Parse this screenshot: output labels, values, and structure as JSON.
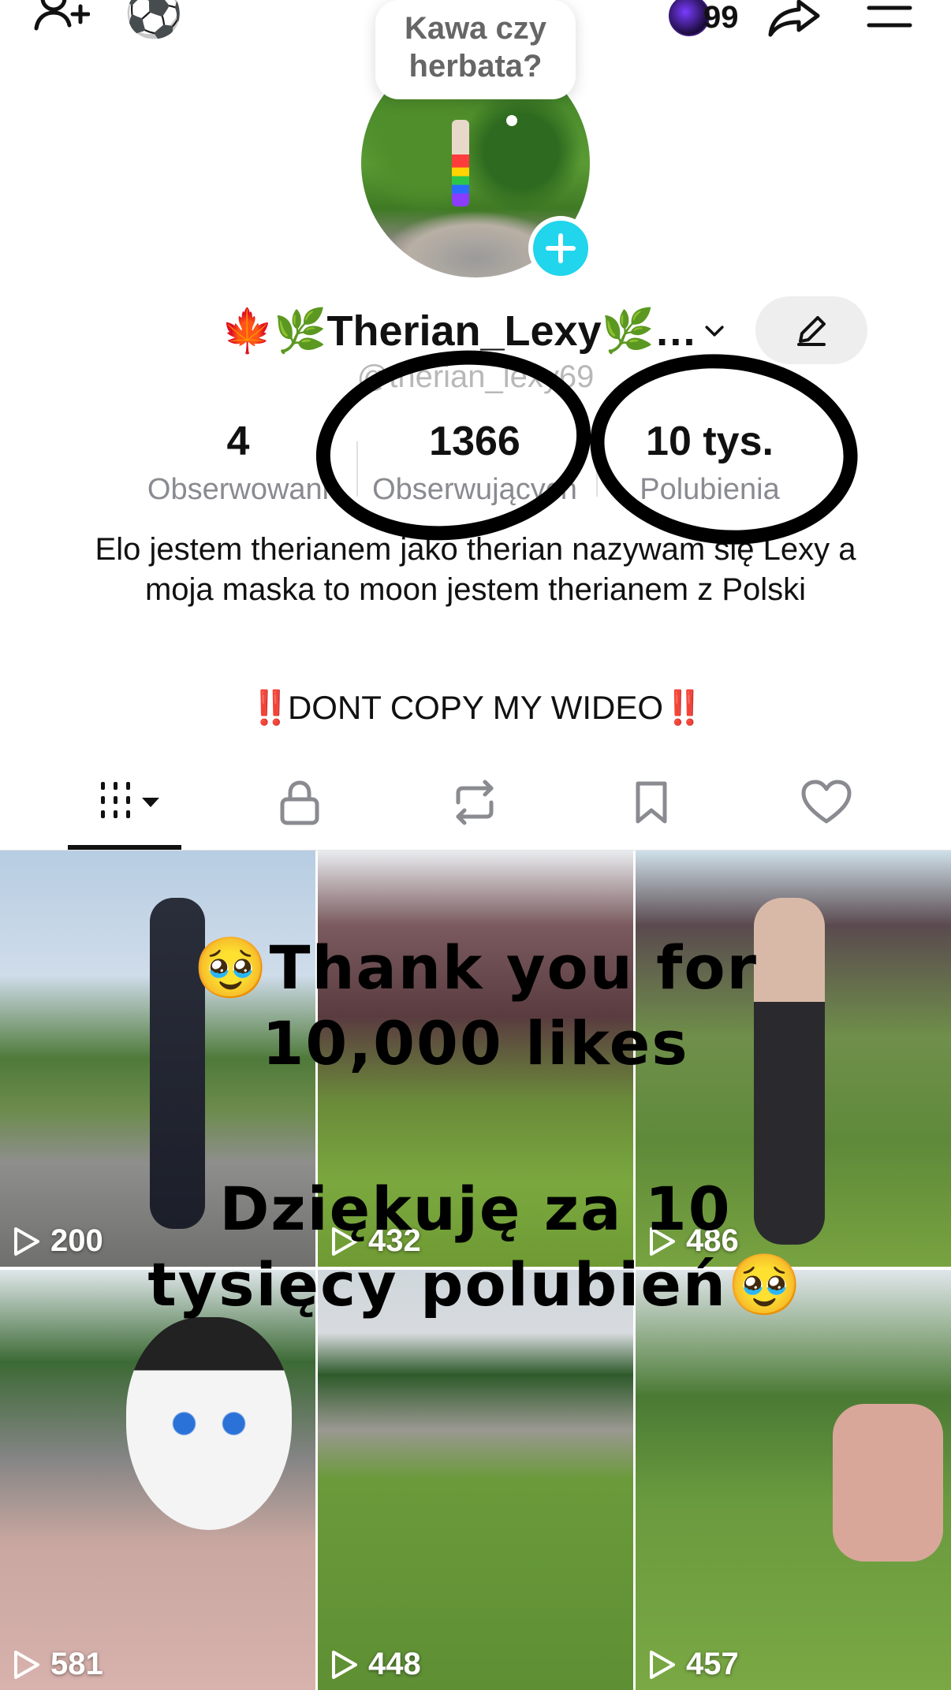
{
  "top_bar": {
    "badge_count": "99",
    "soccer_emoji": "⚽"
  },
  "status_bubble": {
    "text": "Kawa czy herbata?"
  },
  "profile": {
    "display_name": "🍁🌿Therian_Lexy🌿…",
    "username": "@therian_lexy69",
    "stats": [
      {
        "value": "4",
        "label": "Obserwowani"
      },
      {
        "value": "1366",
        "label": "Obserwujących"
      },
      {
        "value": "10 tys.",
        "label": "Polubienia"
      }
    ],
    "bio": "Elo jestem therianem jako therian nazywam się Lexy a moja maska to moon jestem therianem z Polski",
    "slogan_marks": "‼️",
    "slogan_text": "DONT COPY MY WIDEO"
  },
  "tabs": [
    {
      "name": "videos",
      "icon": "grid-icon"
    },
    {
      "name": "private",
      "icon": "lock-icon"
    },
    {
      "name": "reposts",
      "icon": "repost-icon"
    },
    {
      "name": "favorites",
      "icon": "bookmark-icon"
    },
    {
      "name": "liked",
      "icon": "heart-icon"
    }
  ],
  "videos": [
    {
      "views": "200"
    },
    {
      "views": "432"
    },
    {
      "views": "486"
    },
    {
      "views": "581"
    },
    {
      "views": "448"
    },
    {
      "views": "457"
    }
  ],
  "overlay": {
    "line1": "🥹Thank you for 10,000 likes",
    "line2": "Dziękuję za 10 tysięcy polubień🥹"
  },
  "colors": {
    "accent_cyan": "#20d5ec",
    "warning_red": "#e8202a",
    "muted_gray": "#8a8b91"
  }
}
